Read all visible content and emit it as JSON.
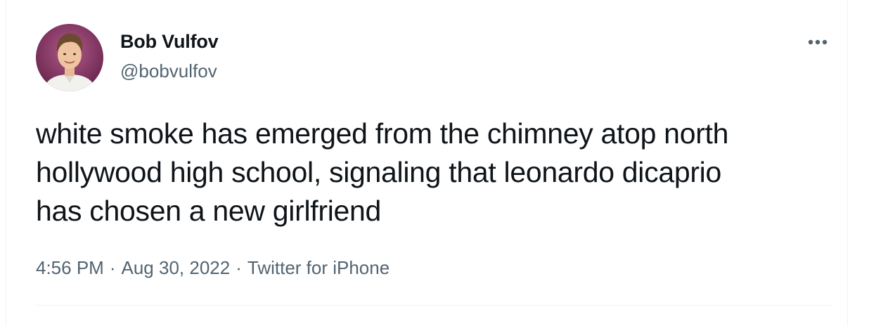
{
  "author": {
    "display_name": "Bob Vulfov",
    "handle": "@bobvulfov",
    "avatar_icon": "user-avatar-photo"
  },
  "more_icon": "more-dots-icon",
  "tweet": {
    "lines": [
      "white smoke has emerged from the chimney atop north",
      "hollywood high school, signaling that leonardo dicaprio",
      "has chosen a new girlfriend"
    ]
  },
  "meta": {
    "time": "4:56 PM",
    "separator": "·",
    "date": "Aug 30, 2022",
    "source": "Twitter for iPhone"
  },
  "colors": {
    "text_primary": "#0f1419",
    "text_secondary": "#536471",
    "divider": "#eff3f4"
  }
}
